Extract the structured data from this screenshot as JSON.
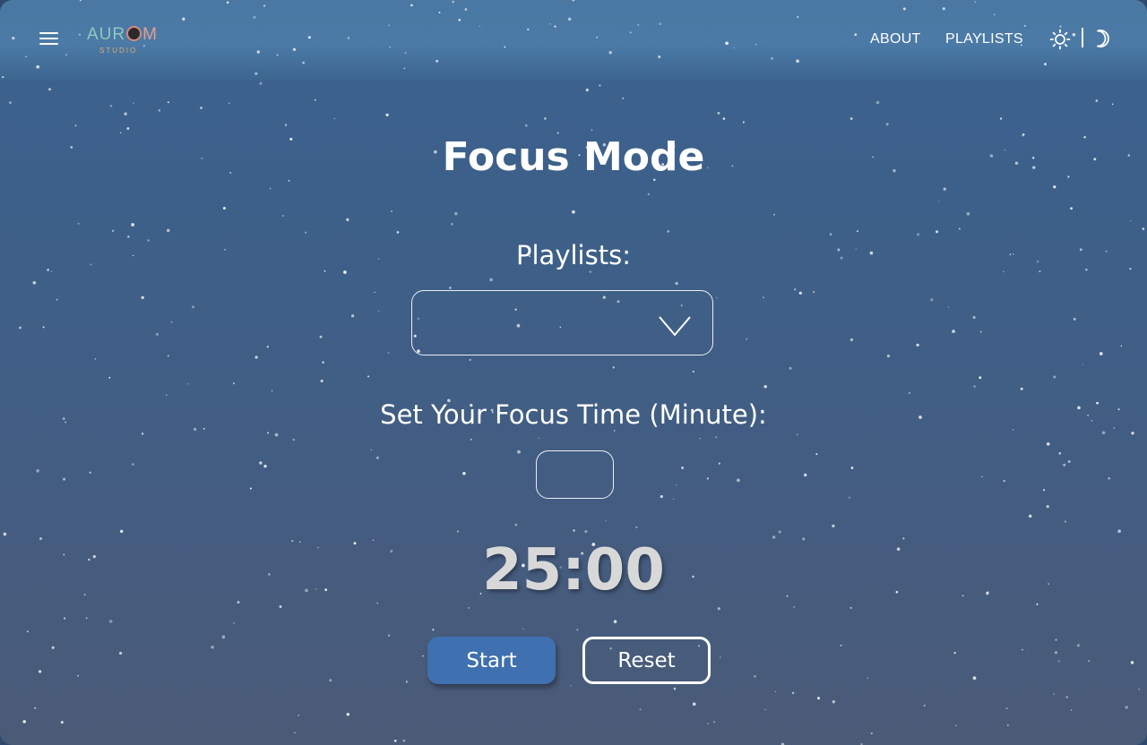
{
  "header": {
    "logo": {
      "main_left": "AUR",
      "main_right": "M",
      "sub": "STUDIO"
    },
    "nav": [
      {
        "label": "ABOUT"
      },
      {
        "label": "PLAYLISTS"
      }
    ],
    "theme_icons": {
      "light": "sun-icon",
      "dark": "moon-icon"
    },
    "menu_icon": "hamburger-menu-icon"
  },
  "main": {
    "title": "Focus Mode",
    "playlists_label": "Playlists:",
    "playlist_select": {
      "selected": "",
      "icon": "chevron-down-icon"
    },
    "focus_time_label": "Set Your Focus Time (Minute):",
    "focus_time_input": {
      "value": "",
      "placeholder": ""
    },
    "timer": "25:00",
    "start_label": "Start",
    "reset_label": "Reset"
  },
  "colors": {
    "background_top": "#3c6290",
    "background_bottom": "#4a5b77",
    "header_band": "#4b7aa6",
    "start_button": "#3f70b0",
    "timer_text": "#d8d8d8"
  }
}
